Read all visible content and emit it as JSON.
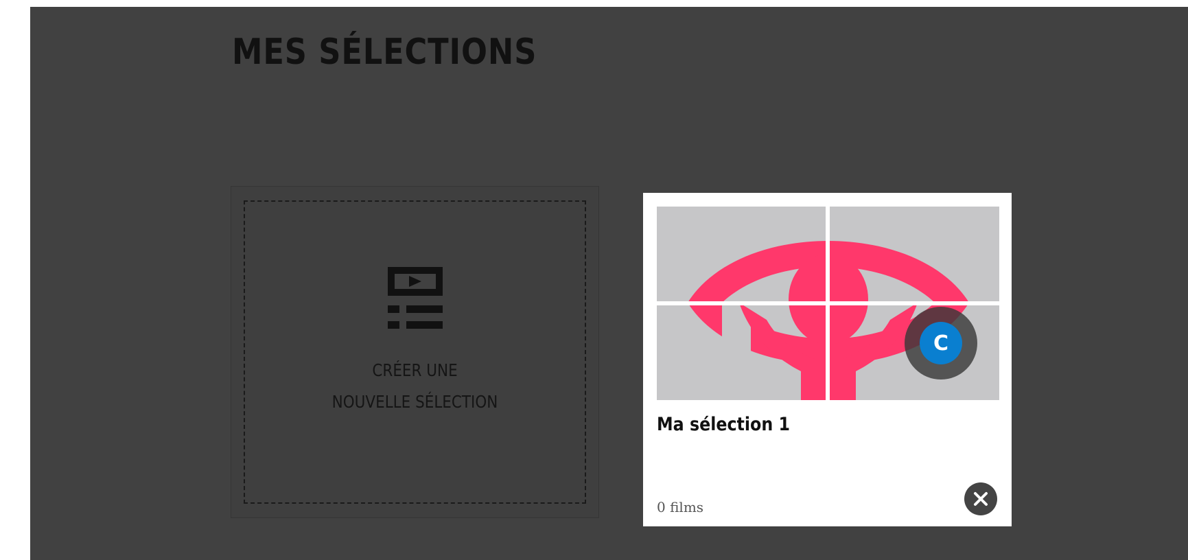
{
  "page": {
    "title": "MES SÉLECTIONS"
  },
  "new_selection": {
    "label_line1": "CRÉER UNE",
    "label_line2": "NOUVELLE SÉLECTION",
    "icon": "playlist-icon"
  },
  "selections": [
    {
      "name": "Ma sélection 1",
      "count": "0 films",
      "badge": "C",
      "thumbnail": "eye-logo-thumbnail",
      "delete_icon": "close-circle-icon"
    }
  ],
  "colors": {
    "panel": "#414141",
    "card": "#ffffff",
    "thumb_bg": "#c6c6c8",
    "logo_pink": "#ff386b",
    "badge_blue": "#0a7fd0"
  }
}
